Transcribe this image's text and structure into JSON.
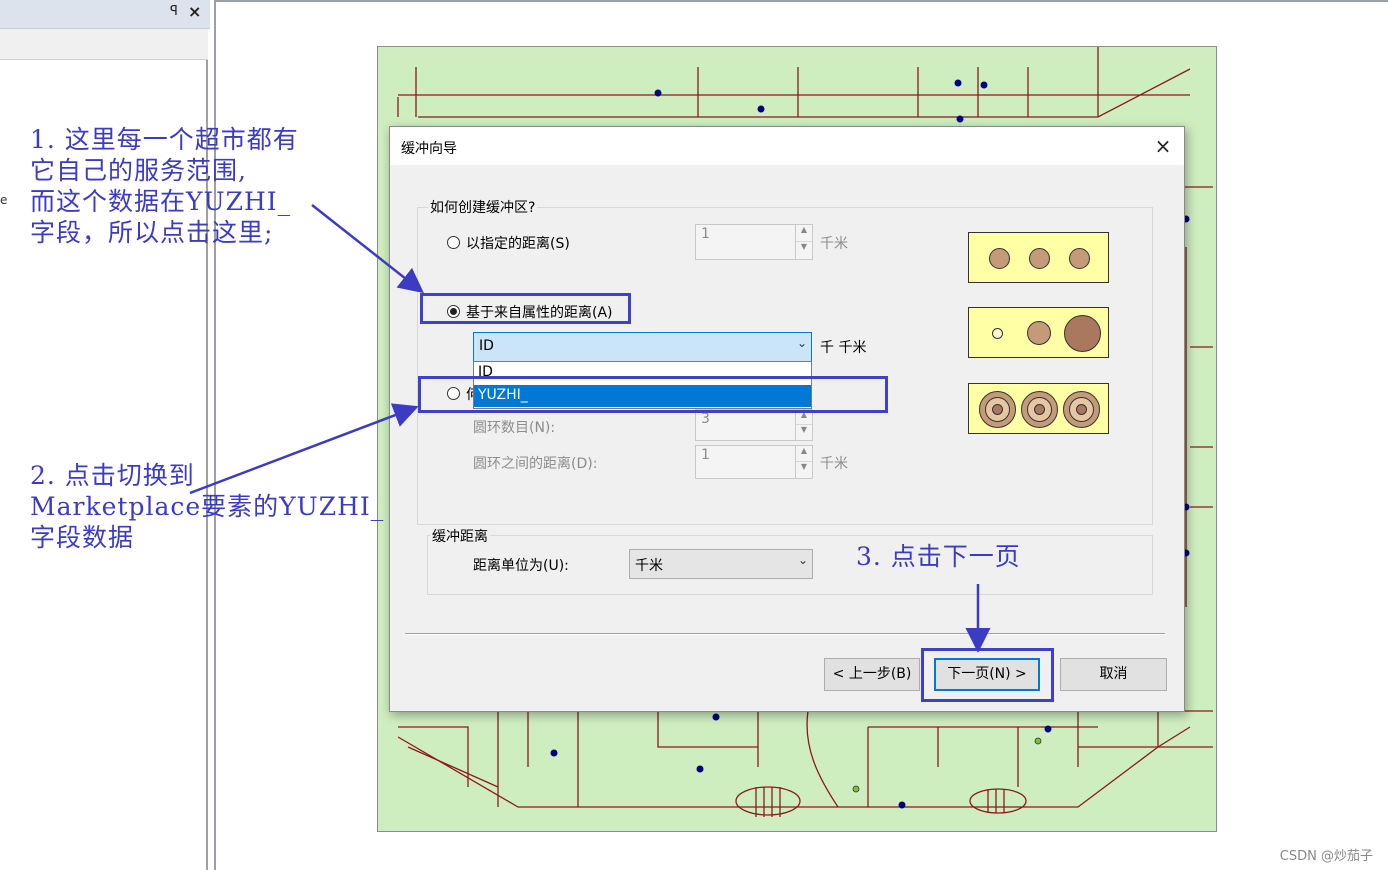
{
  "dialog": {
    "title": "缓冲向导",
    "close_glyph": "×",
    "group_method": {
      "legend": "如何创建缓冲区?",
      "option_specified": {
        "label": "以指定的距离(S)",
        "value": "1",
        "unit": "千米"
      },
      "option_attribute": {
        "label": "基于来自属性的距离(A)",
        "checked": true
      },
      "field_combo": {
        "value": "ID",
        "arrow": "⌄",
        "unit": "千 千米"
      },
      "dropdown_options": [
        "ID",
        "YUZHI_"
      ],
      "dropdown_selected": "YUZHI_",
      "option_multiple": {
        "label": "何"
      },
      "ring_count": {
        "label": "圆环数目(N):",
        "value": "3"
      },
      "ring_distance": {
        "label": "圆环之间的距离(D):",
        "value": "1",
        "unit": "千米"
      }
    },
    "group_units": {
      "legend": "缓冲距离",
      "label": "距离单位为(U):",
      "value": "千米"
    },
    "buttons": {
      "back": "< 上一步(B)",
      "next": "下一页(N) >",
      "cancel": "取消"
    }
  },
  "panel": {
    "pin_glyph": "ꟼ",
    "close_glyph": "×",
    "edge_char": "e"
  },
  "annotations": {
    "note1": [
      "1. 这里每一个超市都有",
      "它自己的服务范围,",
      "而这个数据在YUZHI_",
      "字段，所以点击这里;"
    ],
    "note2": [
      "2. 点击切换到",
      "Marketplace要素的YUZHI_",
      "字段数据"
    ],
    "note3": "3. 点击下一页"
  },
  "watermark": "CSDN @炒茄子",
  "colors": {
    "map_bg": "#cfeec0",
    "road": "#8b1a1a",
    "point": "#000080",
    "annotation": "#3b3bc4",
    "highlight": "#0078d7",
    "preview_bg": "#ffffa6",
    "preview_circle": "#c49a78"
  }
}
